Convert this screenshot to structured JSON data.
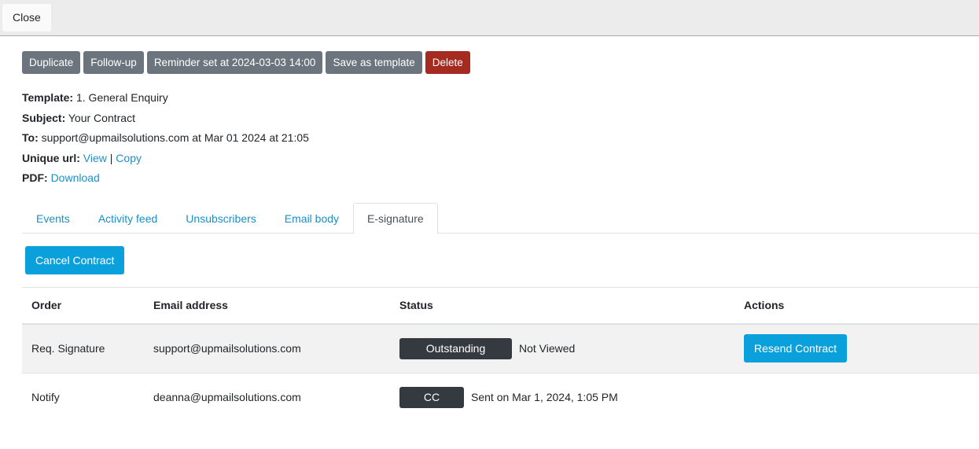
{
  "topbar": {
    "close_label": "Close"
  },
  "toolbar": {
    "duplicate_label": "Duplicate",
    "followup_label": "Follow-up",
    "reminder_label": "Reminder set at 2024-03-03 14:00",
    "save_template_label": "Save as template",
    "delete_label": "Delete",
    "colors": {
      "secondary": "#6c757d",
      "danger": "#a52a20"
    }
  },
  "meta": {
    "template_label": "Template:",
    "template_value": "1. General Enquiry",
    "subject_label": "Subject:",
    "subject_value": "Your Contract",
    "to_label": "To:",
    "to_value": "support@upmailsolutions.com at Mar 01 2024 at 21:05",
    "unique_url_label": "Unique url:",
    "view_link": "View",
    "separator": "|",
    "copy_link": "Copy",
    "pdf_label": "PDF:",
    "download_link": "Download",
    "link_color": "#1a8fc9"
  },
  "tabs": [
    {
      "label": "Events",
      "active": false
    },
    {
      "label": "Activity feed",
      "active": false
    },
    {
      "label": "Unsubscribers",
      "active": false
    },
    {
      "label": "Email body",
      "active": false
    },
    {
      "label": "E-signature",
      "active": true
    }
  ],
  "esign": {
    "cancel_label": "Cancel Contract",
    "primary_color": "#0aa0dc",
    "columns": [
      "Order",
      "Email address",
      "Status",
      "Actions"
    ],
    "rows": [
      {
        "order": "Req. Signature",
        "email": "support@upmailsolutions.com",
        "badge": "Outstanding",
        "status_text": "Not Viewed",
        "action": "Resend Contract"
      },
      {
        "order": "Notify",
        "email": "deanna@upmailsolutions.com",
        "badge": "CC",
        "status_text": "Sent on Mar 1, 2024, 1:05 PM",
        "action": ""
      }
    ]
  }
}
